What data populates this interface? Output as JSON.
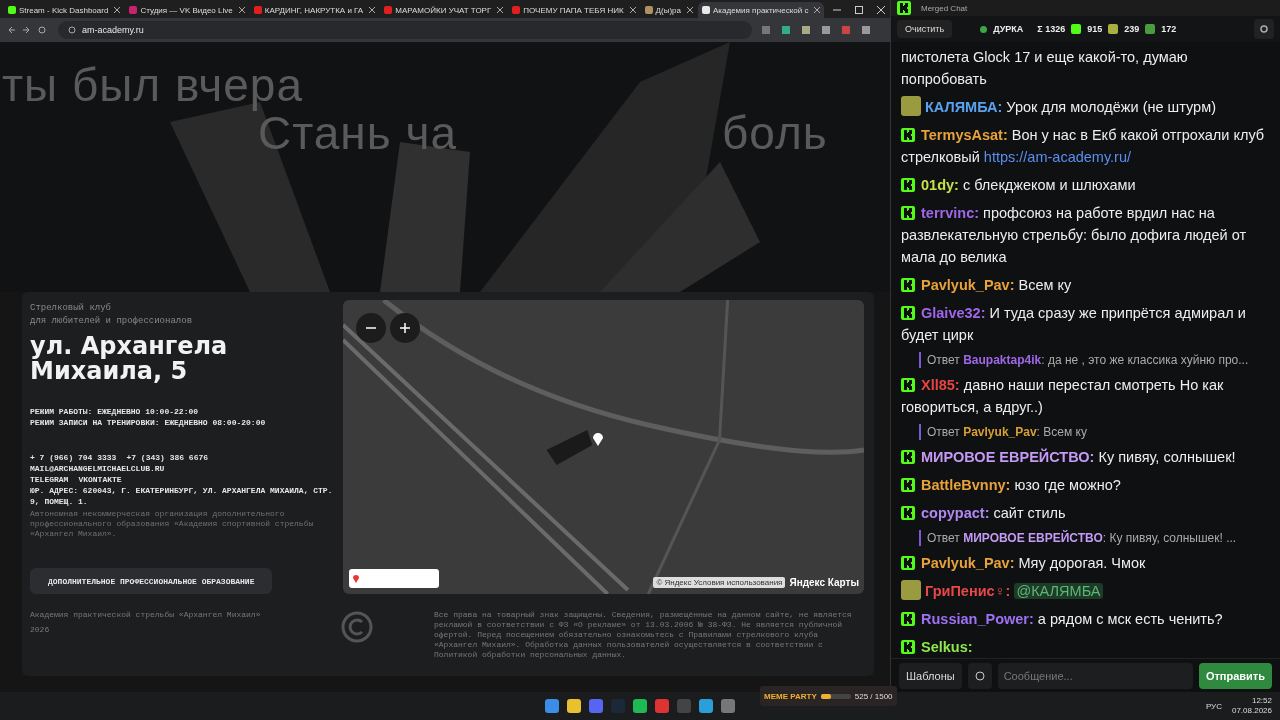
{
  "browser": {
    "tabs": [
      {
        "kind": "kick",
        "title": "Stream - Kick Dashboard",
        "selected": false
      },
      {
        "kind": "vk",
        "title": "Студия — VK Видео Live",
        "selected": false
      },
      {
        "kind": "video",
        "title": "КАРДИНГ, НАКРУТКА и ГА",
        "selected": false
      },
      {
        "kind": "video",
        "title": "МАРАМОЙКИ УЧАТ ТОРГ",
        "selected": false
      },
      {
        "kind": "video",
        "title": "ПОЧЕМУ ПАПА ТЕБЯ НИК",
        "selected": false
      },
      {
        "kind": "avatar",
        "title": "Д(ы)ра",
        "selected": false
      },
      {
        "kind": "site",
        "title": "Академия практической с",
        "selected": true
      }
    ],
    "url": "am-academy.ru"
  },
  "hero": {
    "lines": [
      "ты был вчера",
      "Стань ча",
      "боль"
    ]
  },
  "club": {
    "subtitle": [
      "Стрелковый клуб",
      "для любителей и профессионалов"
    ],
    "address": "ул. Архангела Михаила, 5",
    "hours": [
      "РЕЖИМ РАБОТЫ: ЕЖЕДНЕВНО 10:00-22:00",
      "РЕЖИМ ЗАПИСИ НА ТРЕНИРОВКИ: ЕЖЕДНЕВНО 08:00-20:00"
    ],
    "phones": [
      "+ 7 (966) 704 3333",
      "+7 (343) 386 6676"
    ],
    "email": "MAIL@ARCHANGELMICHAELCLUB.RU",
    "socials": [
      "TELEGRAM",
      "VKONTAKTE"
    ],
    "legal_address": "ЮР. АДРЕС: 620043, Г. ЕКАТЕРИНБУРГ, УЛ. АРХАНГЕЛА МИХАИЛА, СТР. 9, ПОМЕЩ. 1.",
    "organization": "Автономная некоммерческая организация дополнительного профессионального образования «Академия спортивной стрельбы «Архангел Михаил».",
    "button": "ДОПОЛНИТЕЛЬНОЕ ПРОФЕССИОНАЛЬНОЕ ОБРАЗОВАНИЕ"
  },
  "map": {
    "attribution": "© Яндекс Условия использования",
    "logo": "Яндекс Карты"
  },
  "footer": {
    "name": "Академия практической стрельбы «Архангел Михаил»",
    "year": "2026",
    "legal": "Все права на товарный знак защищены. Сведения, размещённые на данном сайте, не является рекламой в соответствии с ФЗ «О рекламе» от 13.03.2006 № 38-ФЗ. Не является публичной офертой. Перед посещением обязательно ознакомьтесь с Правилами стрелкового клуба «Архангел Михаил». Обработка данных пользователей осуществляется в соответствии с Политикой обработки персональных данных."
  },
  "chat": {
    "title": "Merged Chat",
    "clear_button": "Очистить",
    "channel": "ДУРКА",
    "total": "Σ 1326",
    "counts": [
      {
        "kind": "kick",
        "value": "915"
      },
      {
        "kind": "emote",
        "value": "239"
      },
      {
        "kind": "frog",
        "value": "172"
      }
    ],
    "messages": [
      {
        "kind": "continuation",
        "text": "пистолета Glock 17 и еще какой-то, думаю попробовать"
      },
      {
        "kind": "guest",
        "user": "КАЛЯМБА:",
        "color": "#5aa2f0",
        "text": "Урок для молодёжи (не штурм)"
      },
      {
        "kind": "kick",
        "user": "TermysAsat:",
        "color": "#e8a23c",
        "text": "Вон у нас в Екб какой отгрохали клуб стрелковый",
        "link": "https://am-academy.ru/"
      },
      {
        "kind": "kick",
        "user": "01dy:",
        "color": "#c8e048",
        "text": "с блекджеком и шлюхами"
      },
      {
        "kind": "kick",
        "user": "terrvinc:",
        "color": "#a066e8",
        "text": "профсоюз на работе врдил нас на развлекательную стрельбу: было дофига людей от мала до велика"
      },
      {
        "kind": "kick",
        "user": "Pavlyuk_Pav:",
        "color": "#e8a23c",
        "text": "Всем ку"
      },
      {
        "kind": "kick",
        "user": "Glaive32:",
        "color": "#a066e8",
        "text": "И туда сразу же припрётся адмирал и будет цирк"
      },
      {
        "kind": "reply",
        "label": "Ответ",
        "user": "Baupaktap4ik",
        "color": "#a066e8",
        "text": ": да не , это же классика хуйню про..."
      },
      {
        "kind": "kick",
        "user": "Xll85:",
        "color": "#e84444",
        "text": "давно наши перестал смотреть Но как говориться, а вдруг..)"
      },
      {
        "kind": "reply",
        "label": "Ответ",
        "user": "Pavlyuk_Pav",
        "color": "#d8a034",
        "text": ": Всем ку"
      },
      {
        "kind": "kick",
        "user": "МИРОВОЕ ЕВРЕЙСТВО:",
        "color": "#c49af4",
        "text": "Ку пивяу, солнышек!"
      },
      {
        "kind": "kick",
        "user": "BattleBvnny:",
        "color": "#e8a23c",
        "text": "юзо где можно?"
      },
      {
        "kind": "kick",
        "user": "copypact:",
        "color": "#b286f2",
        "text": "сайт стиль"
      },
      {
        "kind": "reply",
        "label": "Ответ",
        "user": "МИРОВОЕ ЕВРЕЙСТВО",
        "color": "#c49af4",
        "text": ": Ку пивяу, солнышек! ..."
      },
      {
        "kind": "kick",
        "user": "Pavlyuk_Pav:",
        "color": "#e8a23c",
        "text": "Мяу дорогая. Чмок"
      },
      {
        "kind": "guest",
        "user": "ГриПенис♀:",
        "color": "#e84848",
        "mention": "@КАЛЯМБА"
      },
      {
        "kind": "kick",
        "user": "Russian_Power:",
        "color": "#9d72f2",
        "text": "а рядом с мск есть ченить?"
      },
      {
        "kind": "kick",
        "user": "Selkus:",
        "color": "#8ee84a"
      }
    ],
    "templates_button": "Шаблоны",
    "placeholder": "Сообщение...",
    "send_button": "Отправить"
  },
  "widget": {
    "title": "MEME PARTY",
    "reading": "525 / 1500",
    "level": 0.35
  },
  "taskbar": {
    "language": "РУС",
    "time": "12:52",
    "date": "07.08.2026"
  }
}
